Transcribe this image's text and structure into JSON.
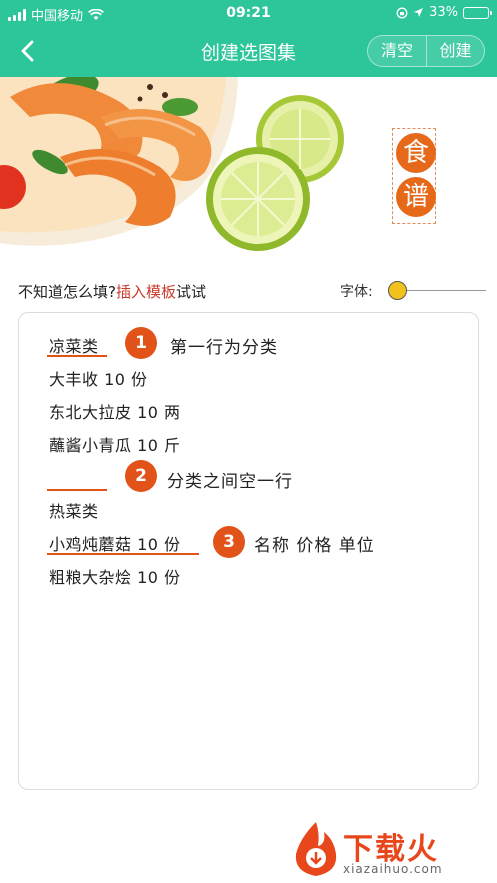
{
  "status_bar": {
    "carrier": "中国移动",
    "time": "09:21",
    "battery": "33%",
    "battery_level": 0.33
  },
  "nav": {
    "title": "创建选图集",
    "clear_label": "清空",
    "create_label": "创建"
  },
  "banner": {
    "seal_chars": [
      "食",
      "谱"
    ]
  },
  "hint": {
    "prefix": "不知道怎么填?",
    "link": "插入模板",
    "suffix": "试试"
  },
  "font": {
    "label": "字体:",
    "level": 0.05
  },
  "editor": {
    "lines": [
      "凉菜类",
      "大丰收  10  份",
      "东北大拉皮  10  两",
      "蘸酱小青瓜  10  斤",
      "",
      "热菜类",
      "小鸡炖蘑菇  10  份",
      "粗粮大杂烩  10  份"
    ],
    "annotations": [
      {
        "number": "1",
        "text": "第一行为分类"
      },
      {
        "number": "2",
        "text": "分类之间空一行"
      },
      {
        "number": "3",
        "text": "名称  价格  单位"
      }
    ]
  },
  "watermark": {
    "text": "下载火",
    "url": "xiazaihuo.com"
  },
  "colors": {
    "primary": "#2dc59a",
    "accent": "#e2531a",
    "link": "#cc3a2c",
    "slider_thumb": "#f1c21b"
  }
}
